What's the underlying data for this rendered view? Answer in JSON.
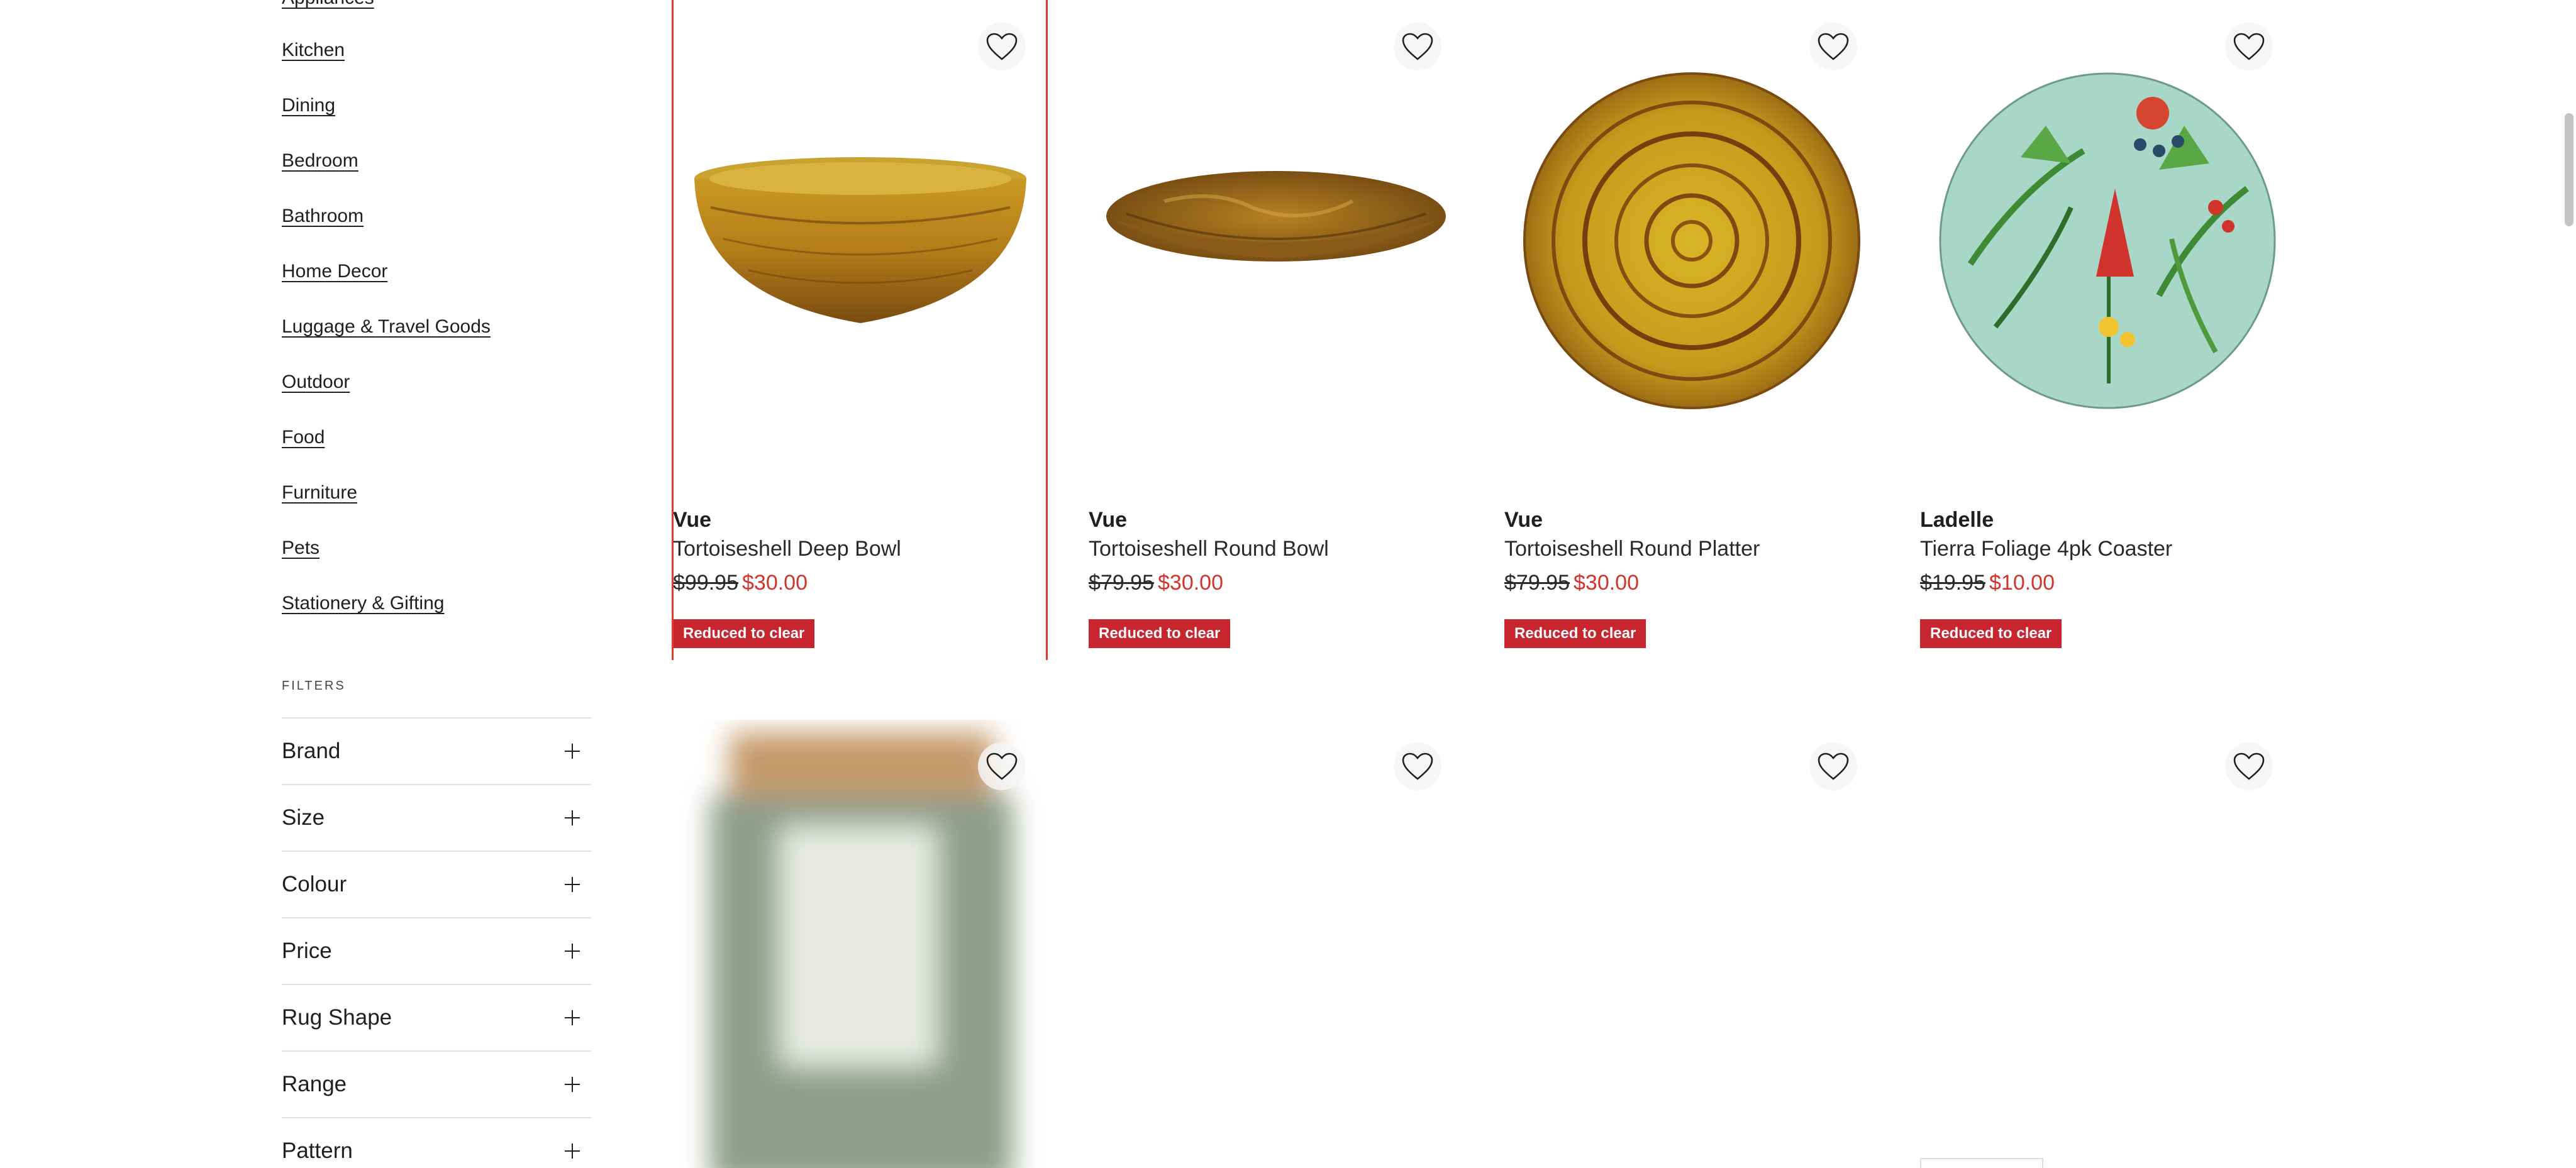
{
  "sidebar": {
    "categories": [
      "Appliances",
      "Kitchen",
      "Dining",
      "Bedroom",
      "Bathroom",
      "Home Decor",
      "Luggage & Travel Goods",
      "Outdoor",
      "Food",
      "Furniture",
      "Pets",
      "Stationery & Gifting"
    ],
    "filters_title": "FILTERS",
    "filters": [
      "Brand",
      "Size",
      "Colour",
      "Price",
      "Rug Shape",
      "Range",
      "Pattern"
    ]
  },
  "products": [
    {
      "brand": "Vue",
      "name": "Tortoiseshell Deep Bowl",
      "old_price": "$99.95",
      "new_price": "$30.00",
      "badge": "Reduced to clear",
      "image_icon": "deep-bowl-image"
    },
    {
      "brand": "Vue",
      "name": "Tortoiseshell Round Bowl",
      "old_price": "$79.95",
      "new_price": "$30.00",
      "badge": "Reduced to clear",
      "image_icon": "round-bowl-image"
    },
    {
      "brand": "Vue",
      "name": "Tortoiseshell Round Platter",
      "old_price": "$79.95",
      "new_price": "$30.00",
      "badge": "Reduced to clear",
      "image_icon": "round-platter-image"
    },
    {
      "brand": "Ladelle",
      "name": "Tierra Foliage 4pk Coaster",
      "old_price": "$19.95",
      "new_price": "$10.00",
      "badge": "Reduced to clear",
      "image_icon": "foliage-coaster-image"
    }
  ],
  "colors": {
    "sale_price": "#d0342c",
    "badge_bg": "#c8262f",
    "focus_outline": "#e23a2f"
  },
  "icons": {
    "wishlist": "heart-icon",
    "expand_filter": "plus-icon"
  }
}
